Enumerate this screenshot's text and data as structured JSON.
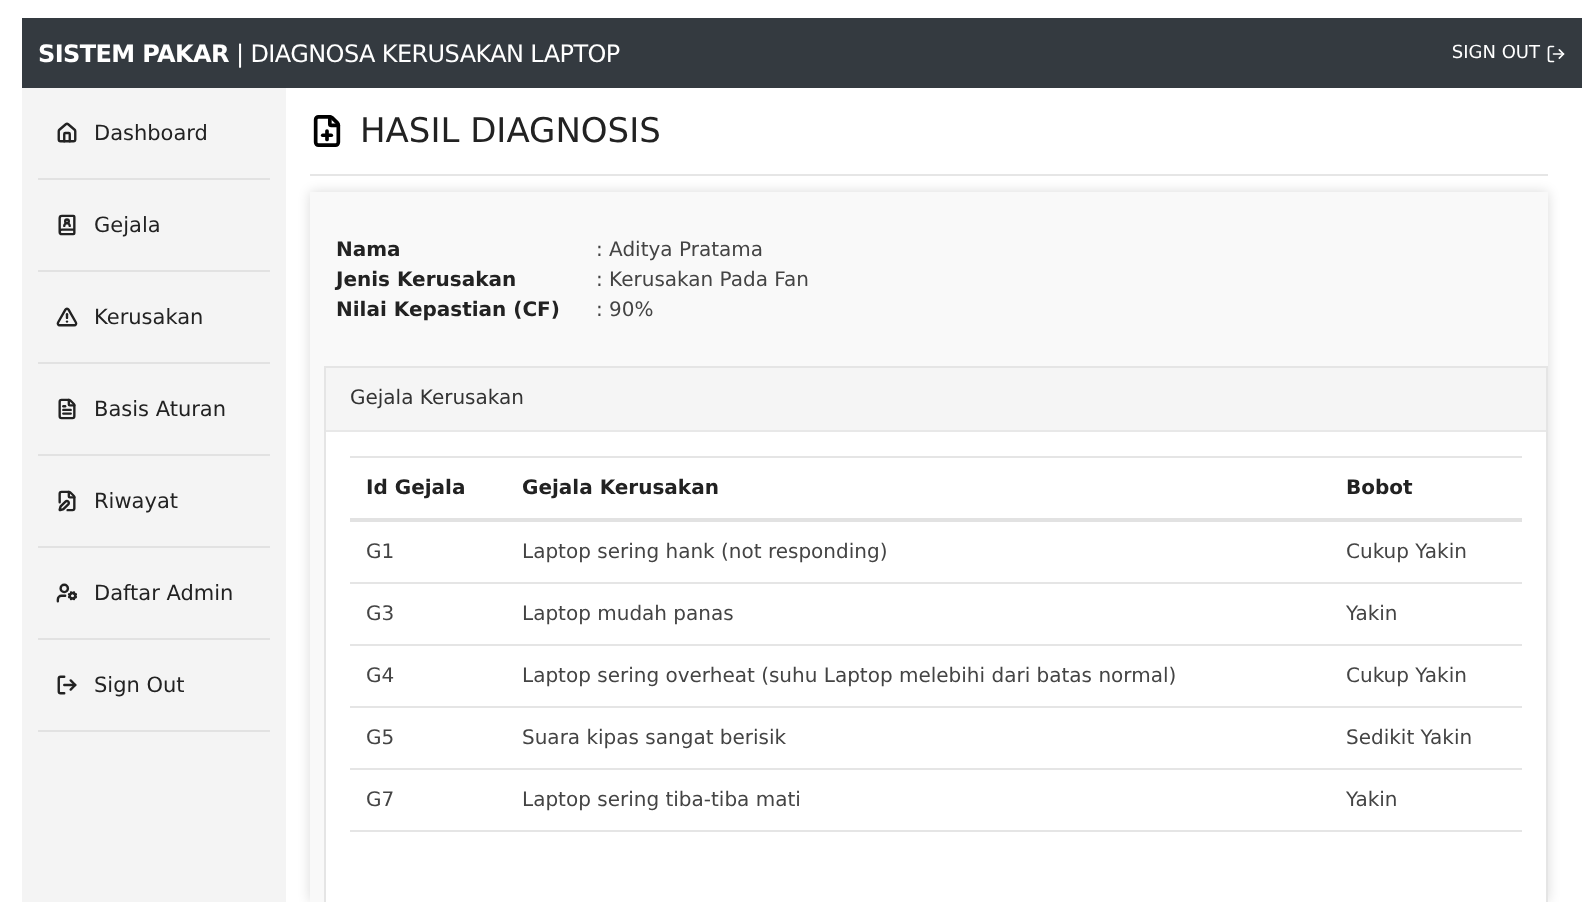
{
  "header": {
    "brand": "**SISTEM PAKAR** | DIAGNOSA KERUSAKAN LAPTOP",
    "sign_out": "SIGN OUT"
  },
  "sidebar": {
    "items": [
      {
        "label": "Dashboard",
        "kind": "home"
      },
      {
        "label": "Gejala",
        "kind": "book"
      },
      {
        "label": "Kerusakan",
        "kind": "warning"
      },
      {
        "label": "Basis Aturan",
        "kind": "file"
      },
      {
        "label": "Riwayat",
        "kind": "edit"
      },
      {
        "label": "Daftar Admin",
        "kind": "users"
      },
      {
        "label": "Sign Out",
        "kind": "signout"
      }
    ]
  },
  "page_title": "HASIL DIAGNOSIS",
  "result": [
    {
      "label": "Nama",
      "value": ": Aditya Pratama"
    },
    {
      "label": "Jenis Kerusakan",
      "value": ": Kerusakan Pada Fan"
    },
    {
      "label": "Nilai Kepastian (CF)",
      "value": ": 90%"
    }
  ],
  "symptoms_panel": {
    "title": "Gejala Kerusakan",
    "columns": [
      "Id Gejala",
      "Gejala Kerusakan",
      "Bobot"
    ],
    "rows": [
      [
        "G1",
        "Laptop sering hank (not responding)",
        "Cukup Yakin"
      ],
      [
        "G3",
        "Laptop mudah panas",
        "Yakin"
      ],
      [
        "G4",
        "Laptop sering overheat (suhu Laptop melebihi dari batas normal)",
        "Cukup Yakin"
      ],
      [
        "G5",
        "Suara kipas sangat berisik",
        "Sedikit Yakin"
      ],
      [
        "G7",
        "Laptop sering tiba-tiba mati",
        "Yakin"
      ]
    ]
  }
}
